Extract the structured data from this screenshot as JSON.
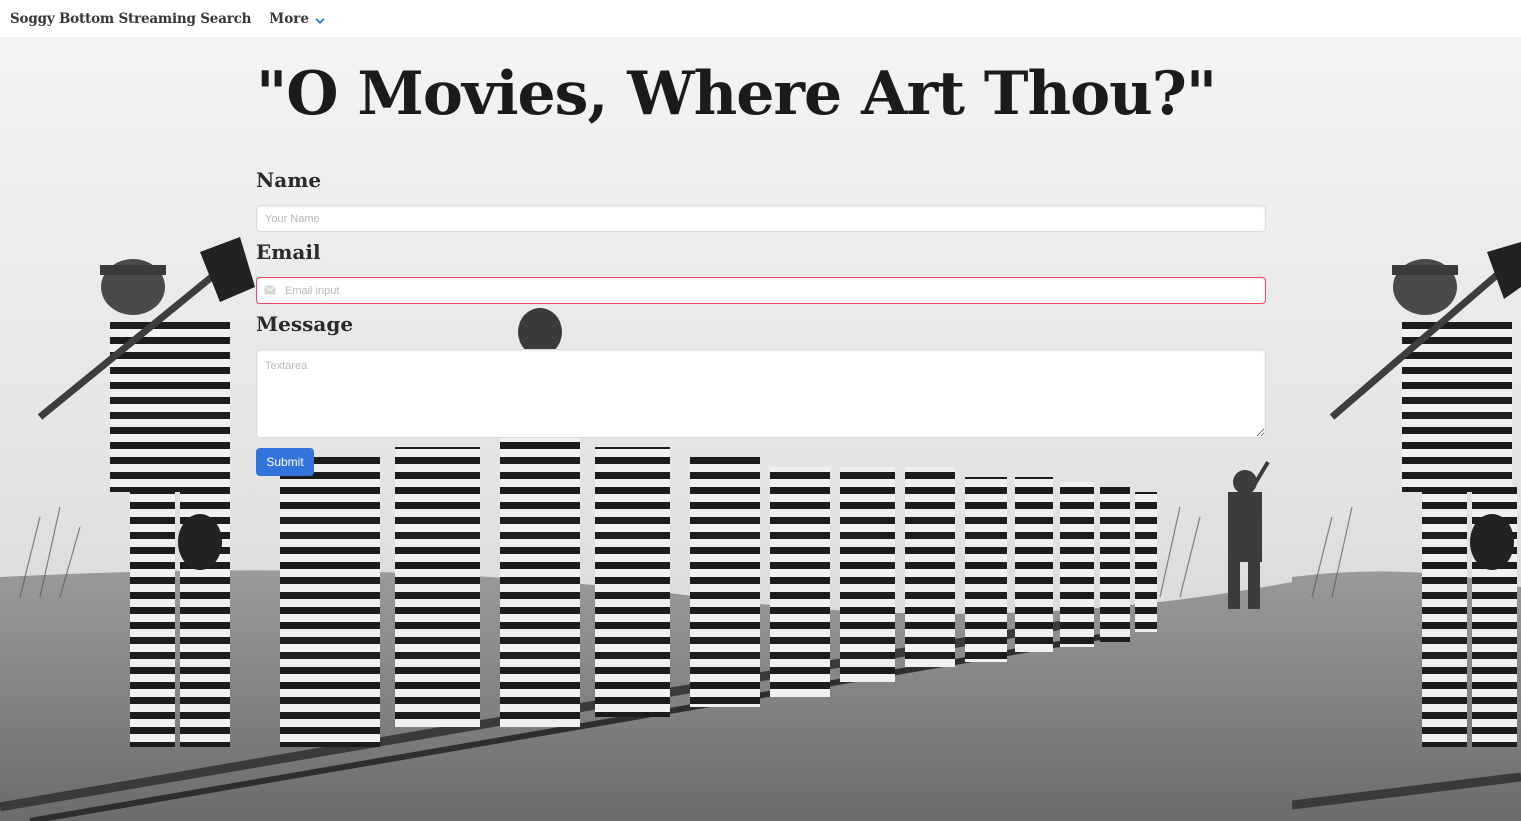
{
  "navbar": {
    "brand": "Soggy Bottom Streaming Search",
    "more_label": "More",
    "more_icon": "chevron-down-icon",
    "accent_color": "#3273dc"
  },
  "hero": {
    "background_image": "black-and-white photograph, repeated on the right"
  },
  "form": {
    "title": "\"O Movies, Where Art Thou?\"",
    "name_label": "Name",
    "name_placeholder": "Your Name",
    "name_value": "",
    "email_label": "Email",
    "email_placeholder": "Email input",
    "email_value": "",
    "email_icon": "envelope-icon",
    "email_border_color": "#f14668",
    "message_label": "Message",
    "message_placeholder": "Textarea",
    "message_value": "",
    "submit_label": "Submit",
    "submit_color": "#3273dc"
  }
}
